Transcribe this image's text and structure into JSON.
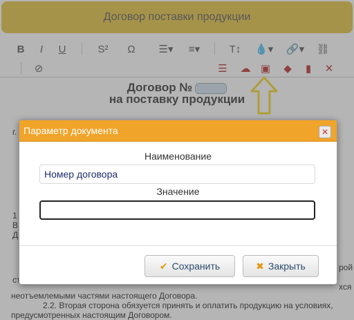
{
  "editor": {
    "title": "Договор поставки продукции",
    "heading_line1": "Договор №",
    "heading_line2": "на поставку продукции",
    "text_lines": [
      "г.",
      "1",
      "В",
      "Д",
      "ст",
      "неотъемлемыми частями настоящего Договора.",
      "2.2. Вторая сторона обязуется принять и оплатить продукцию на условиях,",
      "предусмотренных настоящим Договором."
    ],
    "right_fragments": [
      "рой",
      "хся"
    ]
  },
  "toolbar": {
    "bold": "B",
    "italic": "I",
    "underline": "U",
    "superscript": "S²",
    "special_char": "Ω",
    "font_size": "T↕"
  },
  "modal": {
    "title": "Параметр документа",
    "name_label": "Наименование",
    "name_value": "Номер договора",
    "value_label": "Значение",
    "value_value": "",
    "save_label": "Сохранить",
    "close_label": "Закрыть"
  },
  "colors": {
    "header_yellow": "#e4c13c",
    "modal_header": "#f0a42a",
    "accent_red": "#b72d2d",
    "arrow_yellow": "#f5d323"
  }
}
